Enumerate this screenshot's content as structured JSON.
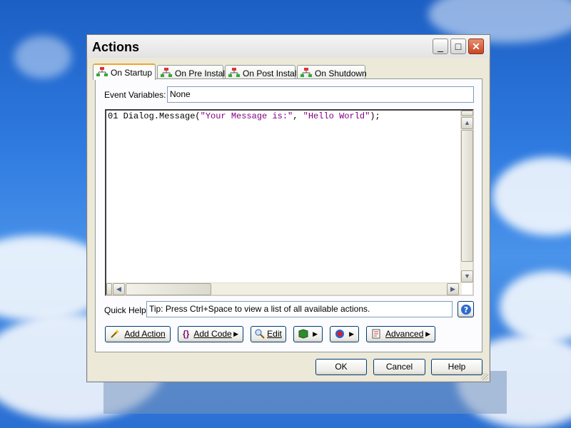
{
  "window": {
    "title": "Actions",
    "controls": {
      "minimize": "_",
      "maximize": "□",
      "close": "✕"
    }
  },
  "tabs": [
    {
      "label": "On Startup",
      "icon": "flowchart-icon",
      "active": true
    },
    {
      "label": "On Pre Install",
      "icon": "flowchart-icon",
      "active": false
    },
    {
      "label": "On Post Install",
      "icon": "flowchart-icon",
      "active": false
    },
    {
      "label": "On Shutdown",
      "icon": "flowchart-icon",
      "active": false
    }
  ],
  "event_variables": {
    "label": "Event Variables:",
    "value": "None"
  },
  "editor": {
    "line_number": "01",
    "code_prefix": " Dialog.Message(",
    "string1": "\"Your Message is:\"",
    "separator": ", ",
    "string2": "\"Hello World\"",
    "code_suffix": ");"
  },
  "quick_help": {
    "label": "Quick Help:",
    "tip": "Tip: Press Ctrl+Space to view a list of all available actions.",
    "help_icon": "question-icon"
  },
  "action_buttons": {
    "add_action": "Add Action",
    "add_code": "Add Code",
    "edit": "Edit",
    "advanced": "Advanced"
  },
  "dialog_buttons": {
    "ok": "OK",
    "cancel": "Cancel",
    "help": "Help"
  },
  "colors": {
    "string": "#800080",
    "tab_highlight": "#f5a623",
    "close_button": "#c8451f"
  }
}
